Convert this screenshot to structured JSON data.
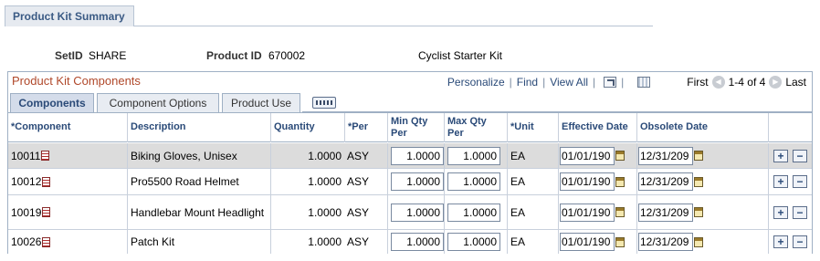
{
  "page_tab": {
    "label": "Product Kit Summary"
  },
  "header": {
    "setid_label": "SetID",
    "setid_value": "SHARE",
    "product_id_label": "Product ID",
    "product_id_value": "670002",
    "product_description": "Cyclist Starter Kit"
  },
  "grid": {
    "title": "Product Kit Components",
    "personalize": "Personalize",
    "find": "Find",
    "view_all": "View All",
    "first": "First",
    "range": "1-4 of 4",
    "last": "Last",
    "prev_icon": "left-arrow-icon",
    "next_icon": "right-arrow-icon",
    "zoom_icon": "zoom-icon",
    "download_icon": "download-icon"
  },
  "tabs": [
    {
      "label": "Components",
      "active": true
    },
    {
      "label": "Component Options",
      "active": false
    },
    {
      "label": "Product Use",
      "active": false
    }
  ],
  "show_all_columns_icon": "show-all-columns-icon",
  "columns": {
    "component": "*Component",
    "description": "Description",
    "quantity": "Quantity",
    "per": "*Per",
    "min_qty_a": "Min Qty",
    "min_qty_b": "Per",
    "max_qty_a": "Max Qty",
    "max_qty_b": "Per",
    "unit": "*Unit",
    "effective_date": "Effective Date",
    "obsolete_date": "Obsolete Date"
  },
  "rows": [
    {
      "component": "10011",
      "description": "Biking Gloves, Unisex",
      "quantity": "1.0000",
      "per": "ASY",
      "min_qty": "1.0000",
      "max_qty": "1.0000",
      "unit": "EA",
      "effective_date": "01/01/190",
      "obsolete_date": "12/31/209"
    },
    {
      "component": "10012",
      "description": "Pro5500 Road Helmet",
      "quantity": "1.0000",
      "per": "ASY",
      "min_qty": "1.0000",
      "max_qty": "1.0000",
      "unit": "EA",
      "effective_date": "01/01/190",
      "obsolete_date": "12/31/209"
    },
    {
      "component": "10019",
      "description": "Handlebar Mount Headlight",
      "quantity": "1.0000",
      "per": "ASY",
      "min_qty": "1.0000",
      "max_qty": "1.0000",
      "unit": "EA",
      "effective_date": "01/01/190",
      "obsolete_date": "12/31/209"
    },
    {
      "component": "10026",
      "description": "Patch Kit",
      "quantity": "1.0000",
      "per": "ASY",
      "min_qty": "1.0000",
      "max_qty": "1.0000",
      "unit": "EA",
      "effective_date": "01/01/190",
      "obsolete_date": "12/31/209"
    }
  ],
  "row_buttons": {
    "add": "+",
    "delete": "−"
  },
  "colors": {
    "title_red": "#b0482a",
    "link_blue": "#2a4a78",
    "selected_row": "#dcdcdc"
  }
}
